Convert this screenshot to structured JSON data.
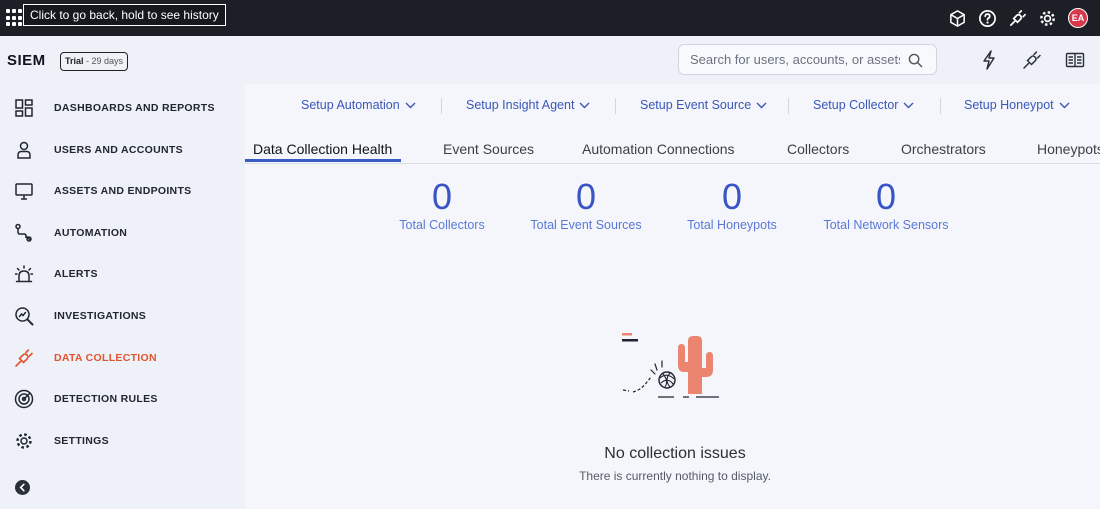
{
  "topbar": {
    "tooltip": "Click to go back, hold to see history",
    "icons": [
      "cube-icon",
      "help-icon",
      "plug-icon",
      "gear-icon"
    ],
    "avatar_initials": "EA"
  },
  "header": {
    "brand": "SIEM",
    "trial_label": "Trial",
    "trial_days": "- 29 days",
    "search_placeholder": "Search for users, accounts, or assets"
  },
  "sidebar": {
    "items": [
      {
        "label": "DASHBOARDS AND REPORTS",
        "icon": "dashboard-icon"
      },
      {
        "label": "USERS AND ACCOUNTS",
        "icon": "user-icon"
      },
      {
        "label": "ASSETS AND ENDPOINTS",
        "icon": "monitor-icon"
      },
      {
        "label": "AUTOMATION",
        "icon": "automation-icon"
      },
      {
        "label": "ALERTS",
        "icon": "alarm-icon"
      },
      {
        "label": "INVESTIGATIONS",
        "icon": "investigation-icon"
      },
      {
        "label": "DATA COLLECTION",
        "icon": "plug-icon",
        "active": true
      },
      {
        "label": "DETECTION RULES",
        "icon": "radar-icon"
      },
      {
        "label": "SETTINGS",
        "icon": "gear-icon"
      }
    ]
  },
  "setup": {
    "links": [
      "Setup Automation",
      "Setup Insight Agent",
      "Setup Event Source",
      "Setup Collector",
      "Setup Honeypot"
    ]
  },
  "tabs": [
    "Data Collection Health",
    "Event Sources",
    "Automation Connections",
    "Collectors",
    "Orchestrators",
    "Honeypots"
  ],
  "stats": [
    {
      "value": "0",
      "label": "Total Collectors"
    },
    {
      "value": "0",
      "label": "Total Event Sources"
    },
    {
      "value": "0",
      "label": "Total Honeypots"
    },
    {
      "value": "0",
      "label": "Total Network Sensors"
    }
  ],
  "empty_state": {
    "title": "No collection issues",
    "subtitle": "There is currently nothing to display."
  },
  "colors": {
    "accent": "#3954c5",
    "active_nav": "#e0552f",
    "cactus": "#ec8570"
  }
}
